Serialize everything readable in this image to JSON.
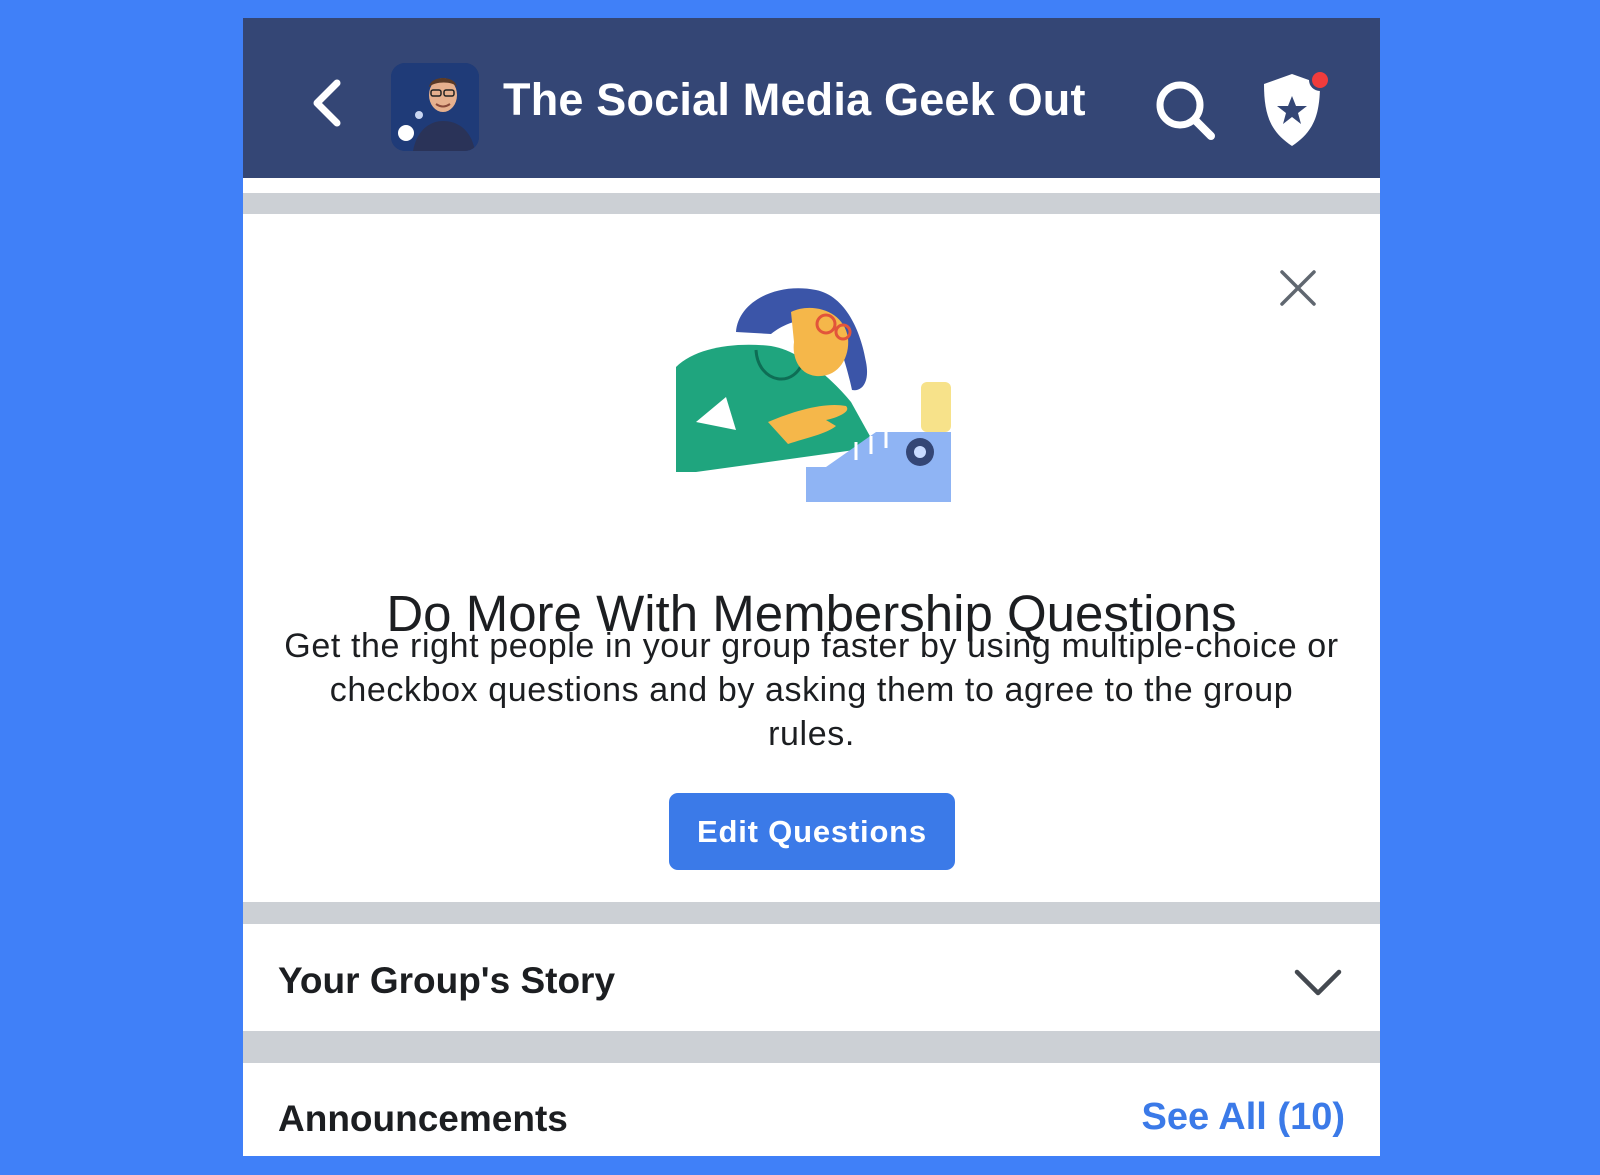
{
  "header": {
    "group_name": "The Social Media Geek Out"
  },
  "promo": {
    "title": "Do More With Membership Questions",
    "body": "Get the right people in your group faster by using multiple-choice or checkbox questions and by asking them to agree to the group rules.",
    "button_label": "Edit Questions"
  },
  "sections": {
    "story_label": "Your Group's Story",
    "announcements_label": "Announcements",
    "see_all_label": "See All (10)"
  },
  "icons": {
    "back": "chevron-left-icon",
    "search": "search-icon",
    "admin_badge": "shield-star-icon",
    "close": "close-icon",
    "expand": "chevron-down-icon"
  },
  "colors": {
    "background": "#4080f8",
    "header": "#344675",
    "accent": "#3b7ae8",
    "separator": "#ccd0d5",
    "notification_dot": "#f03c3c"
  }
}
